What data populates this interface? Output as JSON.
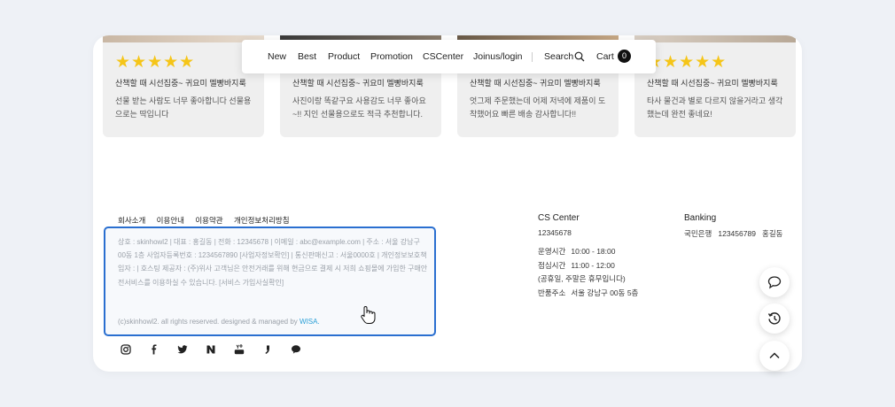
{
  "nav": {
    "items": [
      "New",
      "Best",
      "Product",
      "Promotion",
      "CSCenter",
      "Joinus/login"
    ],
    "search_label": "Search",
    "cart_label": "Cart",
    "cart_count": "0"
  },
  "reviews": [
    {
      "stars": "★★★★★",
      "title": "산책할 때 시선집중~ 귀요미 멜빵바지룩",
      "body": "선물 받는 사람도 너무 좋아합니다 선물용으로는 딱입니다"
    },
    {
      "stars": "★★★★★",
      "title": "산책할 때 시선집중~ 귀요미 멜빵바지룩",
      "body": "사진이랑 똑같구요 사용감도 너무 좋아요~!! 지인 선물용으로도 적극 추천합니다."
    },
    {
      "stars": "★★★★★",
      "title": "산책할 때 시선집중~ 귀요미 멜빵바지룩",
      "body": "엇그제 주문했는데 어제 저녁에 제품이 도착했어요 빠른 배송 감사합니다!!"
    },
    {
      "stars": "★★★★★",
      "title": "산책할 때 시선집중~ 귀요미 멜빵바지룩",
      "body": "타사 물건과 별로 다르지 않을거라고 생각했는데 완전 좋네요!"
    }
  ],
  "footer": {
    "links": [
      "회사소개",
      "이용안내",
      "이용약관",
      "개인정보처리방침"
    ],
    "company_info": "상호 : skinhowl2 | 대표 : 홍길동 | 전화 : 12345678 | 이메일 : abc@example.com | 주소 : 서울 강남구 00동 1층 사업자등록번호 : 1234567890 [사업자정보확인] | 통신판매신고 : 서울0000호 | 개인정보보호책임자 : | 호스팅 제공자 : (주)위사 고객님은 안전거래를 위해 현금으로 결제 시 저희 쇼핑몰에 가입한 구매안전서비스를 이용하실 수 있습니다. [서비스 가입사실확인]",
    "copyright": "(c)skinhowl2. all rights reserved. designed & managed by",
    "wisa": "WISA."
  },
  "social_icons": [
    "instagram-icon",
    "facebook-icon",
    "twitter-icon",
    "naver-icon",
    "youtube-icon",
    "kakaostory-icon",
    "kakaotalk-icon"
  ],
  "cs": {
    "title": "CS Center",
    "phone": "12345678",
    "rows": [
      {
        "k": "운영시간",
        "v": "10:00 - 18:00"
      },
      {
        "k": "점심시간",
        "v": "11:00 - 12:00"
      },
      {
        "k": "",
        "v": "(공휴일, 주말은 휴무입니다)"
      },
      {
        "k": "반품주소",
        "v": "서울 강남구 00동 5층"
      }
    ]
  },
  "banking": {
    "title": "Banking",
    "bank": "국민은행",
    "account": "123456789",
    "holder": "홍길동"
  },
  "colors": {
    "accent_blue": "#2a6fd0",
    "star": "#f5c518",
    "wisa": "#2a9fd6"
  }
}
